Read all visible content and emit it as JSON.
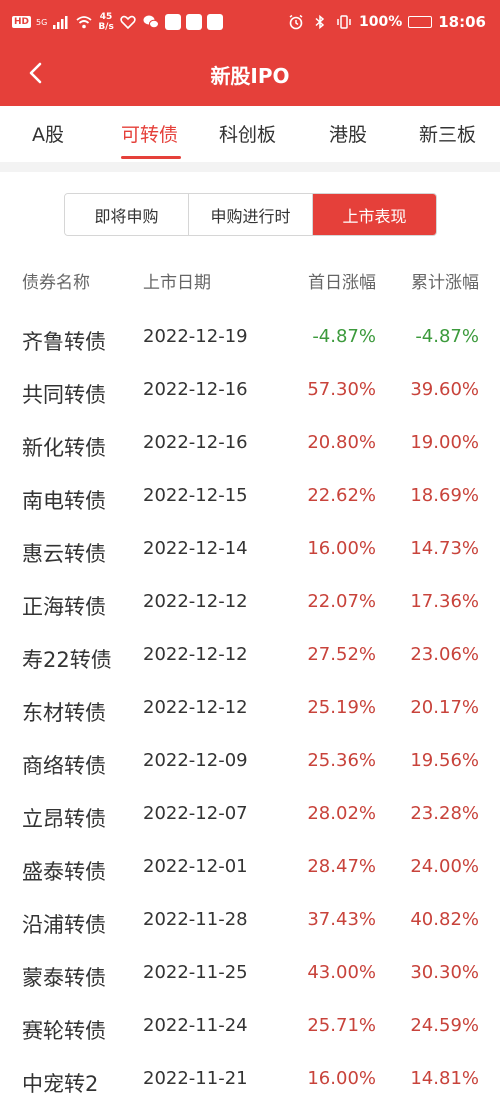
{
  "status_bar": {
    "hd": "HD",
    "signal": "5G",
    "net_speed_value": "45",
    "net_speed_unit": "B/s",
    "battery": "100%",
    "time": "18:06"
  },
  "header": {
    "title": "新股IPO"
  },
  "tabs": [
    {
      "label": "A股",
      "active": false
    },
    {
      "label": "可转债",
      "active": true
    },
    {
      "label": "科创板",
      "active": false
    },
    {
      "label": "港股",
      "active": false
    },
    {
      "label": "新三板",
      "active": false
    }
  ],
  "segments": [
    {
      "label": "即将申购",
      "active": false
    },
    {
      "label": "申购进行时",
      "active": false
    },
    {
      "label": "上市表现",
      "active": true
    }
  ],
  "table": {
    "headers": [
      "债券名称",
      "上市日期",
      "首日涨幅",
      "累计涨幅"
    ],
    "rows": [
      {
        "name": "齐鲁转债",
        "date": "2022-12-19",
        "first_day": "-4.87%",
        "cumulative": "-4.87%"
      },
      {
        "name": "共同转债",
        "date": "2022-12-16",
        "first_day": "57.30%",
        "cumulative": "39.60%"
      },
      {
        "name": "新化转债",
        "date": "2022-12-16",
        "first_day": "20.80%",
        "cumulative": "19.00%"
      },
      {
        "name": "南电转债",
        "date": "2022-12-15",
        "first_day": "22.62%",
        "cumulative": "18.69%"
      },
      {
        "name": "惠云转债",
        "date": "2022-12-14",
        "first_day": "16.00%",
        "cumulative": "14.73%"
      },
      {
        "name": "正海转债",
        "date": "2022-12-12",
        "first_day": "22.07%",
        "cumulative": "17.36%"
      },
      {
        "name": "寿22转债",
        "date": "2022-12-12",
        "first_day": "27.52%",
        "cumulative": "23.06%"
      },
      {
        "name": "东材转债",
        "date": "2022-12-12",
        "first_day": "25.19%",
        "cumulative": "20.17%"
      },
      {
        "name": "商络转债",
        "date": "2022-12-09",
        "first_day": "25.36%",
        "cumulative": "19.56%"
      },
      {
        "name": "立昂转债",
        "date": "2022-12-07",
        "first_day": "28.02%",
        "cumulative": "23.28%"
      },
      {
        "name": "盛泰转债",
        "date": "2022-12-01",
        "first_day": "28.47%",
        "cumulative": "24.00%"
      },
      {
        "name": "沿浦转债",
        "date": "2022-11-28",
        "first_day": "37.43%",
        "cumulative": "40.82%"
      },
      {
        "name": "蒙泰转债",
        "date": "2022-11-25",
        "first_day": "43.00%",
        "cumulative": "30.30%"
      },
      {
        "name": "赛轮转债",
        "date": "2022-11-24",
        "first_day": "25.71%",
        "cumulative": "24.59%"
      },
      {
        "name": "中宠转2",
        "date": "2022-11-21",
        "first_day": "16.00%",
        "cumulative": "14.81%"
      }
    ]
  },
  "colors": {
    "brand": "#e5403a",
    "up": "#c8433b",
    "down": "#3c9a3c"
  }
}
